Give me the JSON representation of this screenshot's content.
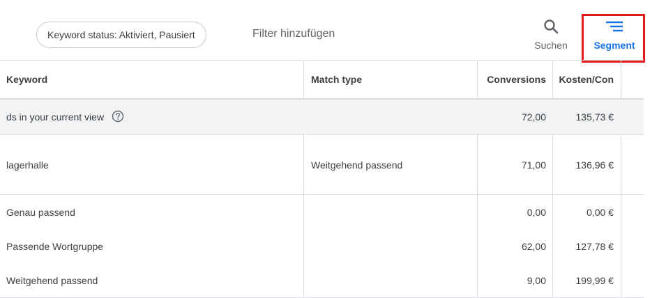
{
  "filter_bar": {
    "chip_label": "Keyword status: Aktiviert, Pausiert",
    "add_filter_label": "Filter hinzufügen"
  },
  "toolbar": {
    "search_label": "Suchen",
    "search_icon": "search-icon",
    "segment_label": "Segment",
    "segment_icon": "segment-icon",
    "accent_color": "#1a73e8",
    "highlight_color": "#e51b1b"
  },
  "table": {
    "headers": {
      "keyword": "Keyword",
      "match_type": "Match type",
      "conversions": "Conversions",
      "cost_per_conv": "Kosten/Con"
    },
    "total_row": {
      "label": "ds in your current view",
      "conversions": "72,00",
      "cost_per_conv": "135,73 €"
    },
    "keyword_row": {
      "keyword": "lagerhalle",
      "match_type": "Weitgehend passend",
      "conversions": "71,00",
      "cost_per_conv": "136,96 €"
    },
    "segment_rows": [
      {
        "label": "Genau passend",
        "conversions": "0,00",
        "cost_per_conv": "0,00 €"
      },
      {
        "label": "Passende Wortgruppe",
        "conversions": "62,00",
        "cost_per_conv": "127,78 €"
      },
      {
        "label": "Weitgehend passend",
        "conversions": "9,00",
        "cost_per_conv": "199,99 €"
      }
    ]
  }
}
